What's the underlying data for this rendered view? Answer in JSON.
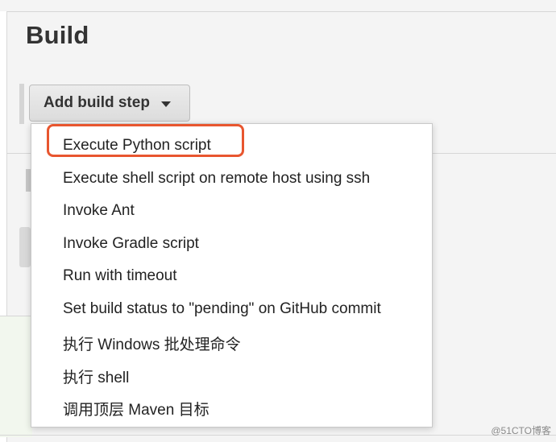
{
  "section": {
    "title": "Build"
  },
  "toolbar": {
    "add_build_step_label": "Add build step",
    "caret_icon": "chevron-down-icon"
  },
  "menu": {
    "items": [
      {
        "label": "Execute Python script",
        "highlighted": true
      },
      {
        "label": "Execute shell script on remote host using ssh"
      },
      {
        "label": "Invoke Ant"
      },
      {
        "label": "Invoke Gradle script"
      },
      {
        "label": "Run with timeout"
      },
      {
        "label": "Set build status to \"pending\" on GitHub commit"
      },
      {
        "label": "执行 Windows 批处理命令"
      },
      {
        "label": "执行 shell"
      },
      {
        "label": "调用顶层 Maven 目标"
      }
    ]
  },
  "colors": {
    "highlight_border": "#e8562f"
  },
  "watermark": "@51CTO博客"
}
